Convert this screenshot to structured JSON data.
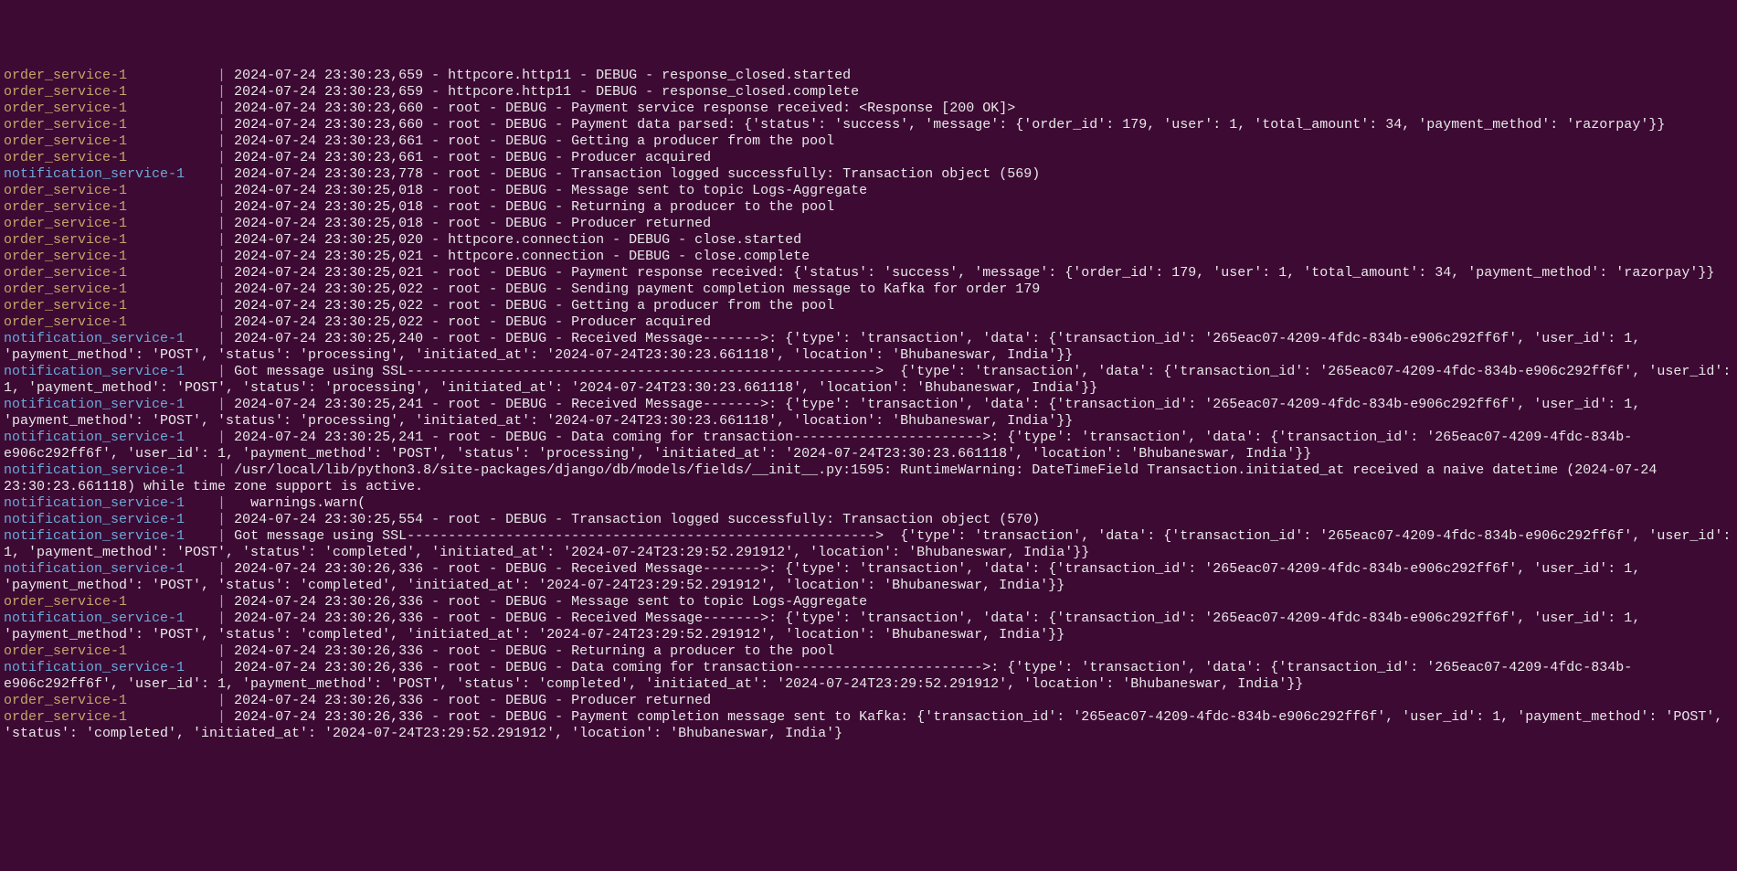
{
  "service_labels": {
    "order": "order_service-1",
    "notification": "notification_service-1"
  },
  "pad_width": 26,
  "pipe": "|",
  "lines": [
    {
      "svc": "order",
      "text": "2024-07-24 23:30:23,659 - httpcore.http11 - DEBUG - response_closed.started"
    },
    {
      "svc": "order",
      "text": "2024-07-24 23:30:23,659 - httpcore.http11 - DEBUG - response_closed.complete"
    },
    {
      "svc": "order",
      "text": "2024-07-24 23:30:23,660 - root - DEBUG - Payment service response received: <Response [200 OK]>"
    },
    {
      "svc": "order",
      "text": "2024-07-24 23:30:23,660 - root - DEBUG - Payment data parsed: {'status': 'success', 'message': {'order_id': 179, 'user': 1, 'total_amount': 34, 'payment_method': 'razorpay'}}"
    },
    {
      "svc": "order",
      "text": "2024-07-24 23:30:23,661 - root - DEBUG - Getting a producer from the pool"
    },
    {
      "svc": "order",
      "text": "2024-07-24 23:30:23,661 - root - DEBUG - Producer acquired"
    },
    {
      "svc": "notification",
      "text": "2024-07-24 23:30:23,778 - root - DEBUG - Transaction logged successfully: Transaction object (569)"
    },
    {
      "svc": "order",
      "text": "2024-07-24 23:30:25,018 - root - DEBUG - Message sent to topic Logs-Aggregate"
    },
    {
      "svc": "order",
      "text": "2024-07-24 23:30:25,018 - root - DEBUG - Returning a producer to the pool"
    },
    {
      "svc": "order",
      "text": "2024-07-24 23:30:25,018 - root - DEBUG - Producer returned"
    },
    {
      "svc": "order",
      "text": "2024-07-24 23:30:25,020 - httpcore.connection - DEBUG - close.started"
    },
    {
      "svc": "order",
      "text": "2024-07-24 23:30:25,021 - httpcore.connection - DEBUG - close.complete"
    },
    {
      "svc": "order",
      "text": "2024-07-24 23:30:25,021 - root - DEBUG - Payment response received: {'status': 'success', 'message': {'order_id': 179, 'user': 1, 'total_amount': 34, 'payment_method': 'razorpay'}}"
    },
    {
      "svc": "order",
      "text": "2024-07-24 23:30:25,022 - root - DEBUG - Sending payment completion message to Kafka for order 179"
    },
    {
      "svc": "order",
      "text": "2024-07-24 23:30:25,022 - root - DEBUG - Getting a producer from the pool"
    },
    {
      "svc": "order",
      "text": "2024-07-24 23:30:25,022 - root - DEBUG - Producer acquired"
    },
    {
      "svc": "notification",
      "text": "2024-07-24 23:30:25,240 - root - DEBUG - Received Message------->: {'type': 'transaction', 'data': {'transaction_id': '265eac07-4209-4fdc-834b-e906c292ff6f', 'user_id': 1, 'payment_method': 'POST', 'status': 'processing', 'initiated_at': '2024-07-24T23:30:23.661118', 'location': 'Bhubaneswar, India'}}"
    },
    {
      "svc": "notification",
      "text": "Got message using SSL--------------------------------------------------------->  {'type': 'transaction', 'data': {'transaction_id': '265eac07-4209-4fdc-834b-e906c292ff6f', 'user_id': 1, 'payment_method': 'POST', 'status': 'processing', 'initiated_at': '2024-07-24T23:30:23.661118', 'location': 'Bhubaneswar, India'}}"
    },
    {
      "svc": "notification",
      "text": "2024-07-24 23:30:25,241 - root - DEBUG - Received Message------->: {'type': 'transaction', 'data': {'transaction_id': '265eac07-4209-4fdc-834b-e906c292ff6f', 'user_id': 1, 'payment_method': 'POST', 'status': 'processing', 'initiated_at': '2024-07-24T23:30:23.661118', 'location': 'Bhubaneswar, India'}}"
    },
    {
      "svc": "notification",
      "text": "2024-07-24 23:30:25,241 - root - DEBUG - Data coming for transaction----------------------->: {'type': 'transaction', 'data': {'transaction_id': '265eac07-4209-4fdc-834b-e906c292ff6f', 'user_id': 1, 'payment_method': 'POST', 'status': 'processing', 'initiated_at': '2024-07-24T23:30:23.661118', 'location': 'Bhubaneswar, India'}}"
    },
    {
      "svc": "notification",
      "text": "/usr/local/lib/python3.8/site-packages/django/db/models/fields/__init__.py:1595: RuntimeWarning: DateTimeField Transaction.initiated_at received a naive datetime (2024-07-24 23:30:23.661118) while time zone support is active."
    },
    {
      "svc": "notification",
      "text": "  warnings.warn("
    },
    {
      "svc": "notification",
      "text": "2024-07-24 23:30:25,554 - root - DEBUG - Transaction logged successfully: Transaction object (570)"
    },
    {
      "svc": "notification",
      "text": "Got message using SSL--------------------------------------------------------->  {'type': 'transaction', 'data': {'transaction_id': '265eac07-4209-4fdc-834b-e906c292ff6f', 'user_id': 1, 'payment_method': 'POST', 'status': 'completed', 'initiated_at': '2024-07-24T23:29:52.291912', 'location': 'Bhubaneswar, India'}}"
    },
    {
      "svc": "notification",
      "text": "2024-07-24 23:30:26,336 - root - DEBUG - Received Message------->: {'type': 'transaction', 'data': {'transaction_id': '265eac07-4209-4fdc-834b-e906c292ff6f', 'user_id': 1, 'payment_method': 'POST', 'status': 'completed', 'initiated_at': '2024-07-24T23:29:52.291912', 'location': 'Bhubaneswar, India'}}"
    },
    {
      "svc": "order",
      "text": "2024-07-24 23:30:26,336 - root - DEBUG - Message sent to topic Logs-Aggregate"
    },
    {
      "svc": "notification",
      "text": "2024-07-24 23:30:26,336 - root - DEBUG - Received Message------->: {'type': 'transaction', 'data': {'transaction_id': '265eac07-4209-4fdc-834b-e906c292ff6f', 'user_id': 1, 'payment_method': 'POST', 'status': 'completed', 'initiated_at': '2024-07-24T23:29:52.291912', 'location': 'Bhubaneswar, India'}}"
    },
    {
      "svc": "order",
      "text": "2024-07-24 23:30:26,336 - root - DEBUG - Returning a producer to the pool"
    },
    {
      "svc": "notification",
      "text": "2024-07-24 23:30:26,336 - root - DEBUG - Data coming for transaction----------------------->: {'type': 'transaction', 'data': {'transaction_id': '265eac07-4209-4fdc-834b-e906c292ff6f', 'user_id': 1, 'payment_method': 'POST', 'status': 'completed', 'initiated_at': '2024-07-24T23:29:52.291912', 'location': 'Bhubaneswar, India'}}"
    },
    {
      "svc": "order",
      "text": "2024-07-24 23:30:26,336 - root - DEBUG - Producer returned"
    },
    {
      "svc": "order",
      "text": "2024-07-24 23:30:26,336 - root - DEBUG - Payment completion message sent to Kafka: {'transaction_id': '265eac07-4209-4fdc-834b-e906c292ff6f', 'user_id': 1, 'payment_method': 'POST', 'status': 'completed', 'initiated_at': '2024-07-24T23:29:52.291912', 'location': 'Bhubaneswar, India'}"
    }
  ]
}
